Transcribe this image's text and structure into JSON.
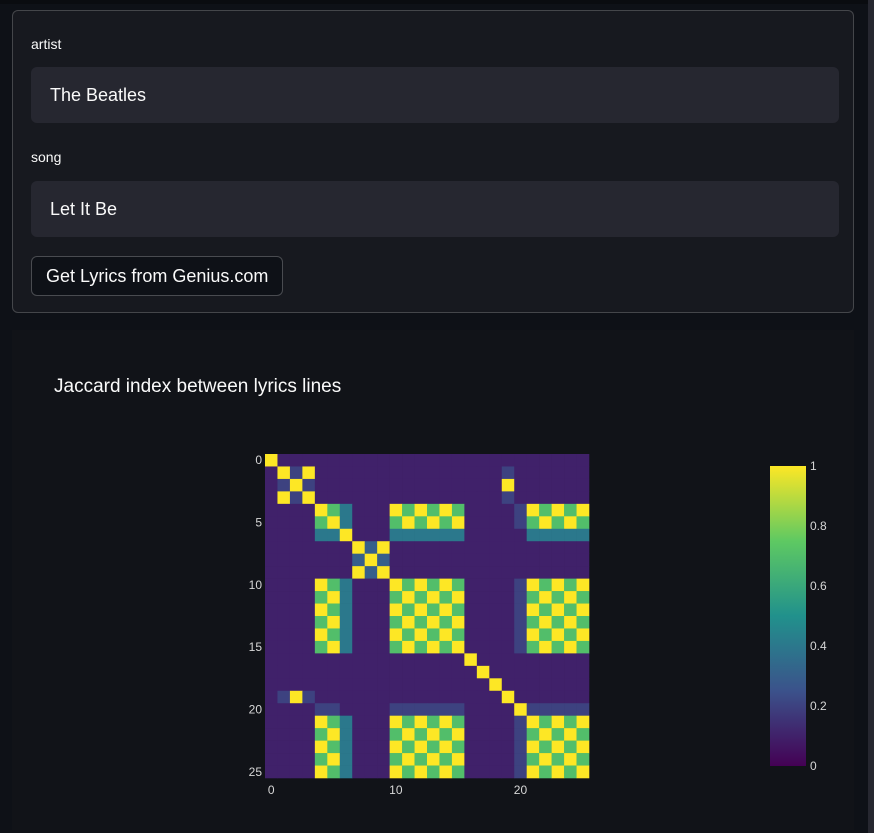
{
  "form": {
    "artist_label": "artist",
    "artist_value": "The Beatles",
    "song_label": "song",
    "song_value": "Let It Be",
    "button_label": "Get Lyrics from Genius.com"
  },
  "colors": {
    "background": "#0e1117",
    "input_bg": "#262730",
    "colormap": [
      "#440154",
      "#3b528b",
      "#21918c",
      "#5ec962",
      "#fde725"
    ]
  },
  "chart_data": {
    "type": "heatmap",
    "title": "Jaccard index between lyrics lines",
    "x_ticks": [
      "0",
      "10",
      "20"
    ],
    "y_ticks": [
      "0",
      "5",
      "10",
      "15",
      "20",
      "25"
    ],
    "colorbar_ticks": [
      "0",
      "0.2",
      "0.4",
      "0.6",
      "0.8",
      "1"
    ],
    "zlim": [
      0,
      1
    ],
    "size": 26,
    "groups": [
      0,
      1,
      2,
      1,
      3,
      4,
      5,
      6,
      7,
      6,
      3,
      4,
      3,
      4,
      3,
      4,
      8,
      9,
      10,
      2,
      11,
      3,
      4,
      3,
      4,
      3
    ],
    "group_similarity": {
      "1-2": 0.2,
      "3-4": 0.7,
      "3-5": 0.4,
      "4-5": 0.4,
      "6-7": 0.3,
      "3-11": 0.2,
      "4-11": 0.2
    },
    "base_similarity": 0.1
  }
}
